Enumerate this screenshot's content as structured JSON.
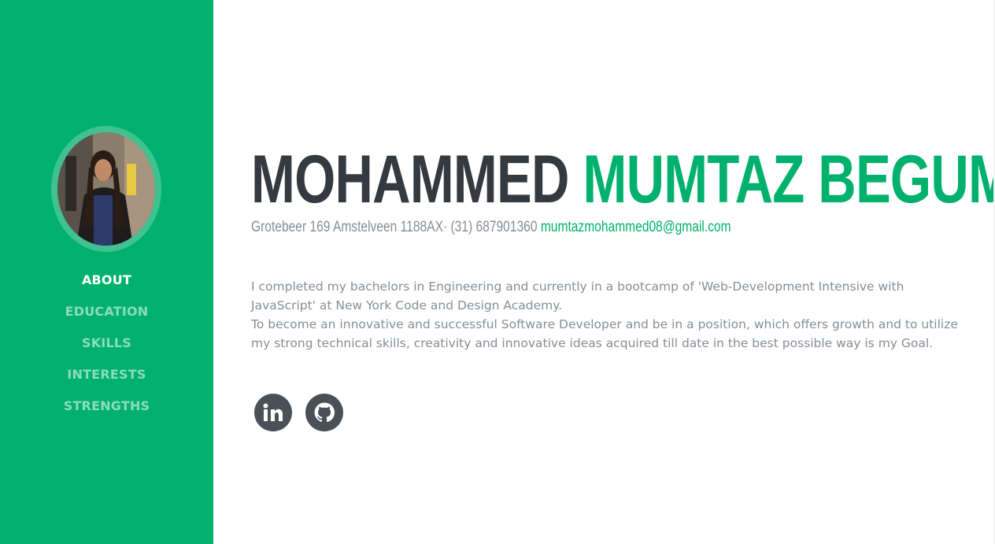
{
  "sidebar": {
    "nav": [
      {
        "label": "ABOUT",
        "active": true
      },
      {
        "label": "EDUCATION",
        "active": false
      },
      {
        "label": "SKILLS",
        "active": false
      },
      {
        "label": "INTERESTS",
        "active": false
      },
      {
        "label": "STRENGTHS",
        "active": false
      }
    ]
  },
  "profile": {
    "first_name": "MOHAMMED",
    "last_name": "MUMTAZ BEGUM",
    "address": "Grotebeer 169 Amstelveen 1188AX· (31) 687901360",
    "email": "mumtazmohammed08@gmail.com"
  },
  "about": {
    "line1": "I completed my bachelors in Engineering and currently in a bootcamp of 'Web-Development Intensive with JavaScript' at New York Code and Design Academy.",
    "line2": "To become an innovative and successful Software Developer and be in a position, which offers growth and to utilize my strong technical skills, creativity and innovative ideas acquired till date in the best possible way is my Goal."
  },
  "social": [
    {
      "icon": "linkedin-icon"
    },
    {
      "icon": "github-icon"
    }
  ],
  "colors": {
    "accent": "#00b16e",
    "dark": "#343a40",
    "muted": "#868e96",
    "icon_bg": "#495057"
  }
}
